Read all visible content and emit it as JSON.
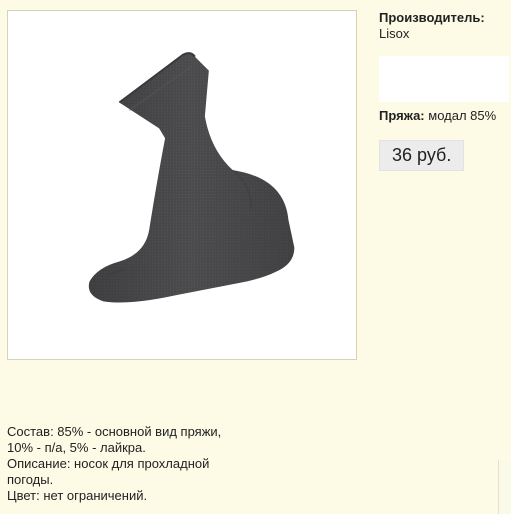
{
  "product": {
    "image_alt": "Носок"
  },
  "info": {
    "manufacturer_label": "Производитель:",
    "manufacturer_value": "Lisox",
    "yarn_label": "Пряжа:",
    "yarn_value": "модал 85%",
    "price": "36 руб."
  },
  "description": {
    "lines": [
      "Состав: 85% - основной вид пряжи,",
      "10% - п/а, 5% - лайкра.",
      "Описание: носок для прохладной",
      "погоды.",
      "Цвет: нет ограничений."
    ]
  },
  "colors": {
    "background": "#fdfbe6",
    "sock": "#4a4a4c",
    "price_bg": "#ececec"
  }
}
